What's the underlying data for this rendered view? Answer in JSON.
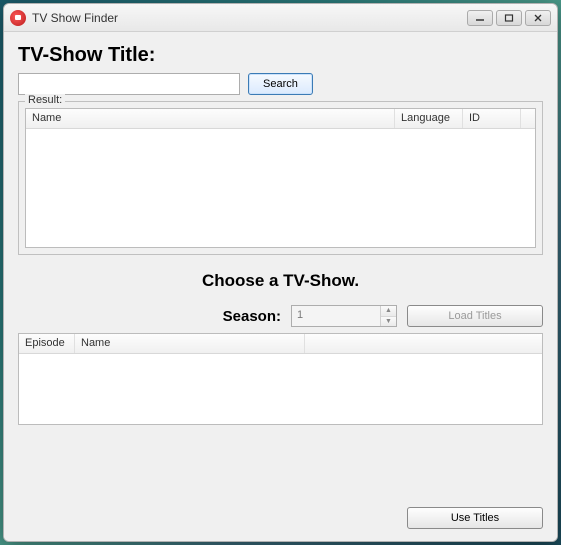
{
  "window": {
    "title": "TV Show Finder"
  },
  "search": {
    "heading": "TV-Show Title:",
    "input_value": "",
    "button": "Search"
  },
  "result": {
    "legend": "Result:",
    "columns": {
      "name": "Name",
      "language": "Language",
      "id": "ID"
    }
  },
  "choose_label": "Choose a TV-Show.",
  "season": {
    "label": "Season:",
    "value": "1",
    "load_button": "Load Titles"
  },
  "episodes": {
    "columns": {
      "episode": "Episode",
      "name": "Name"
    }
  },
  "footer": {
    "use_button": "Use Titles"
  }
}
